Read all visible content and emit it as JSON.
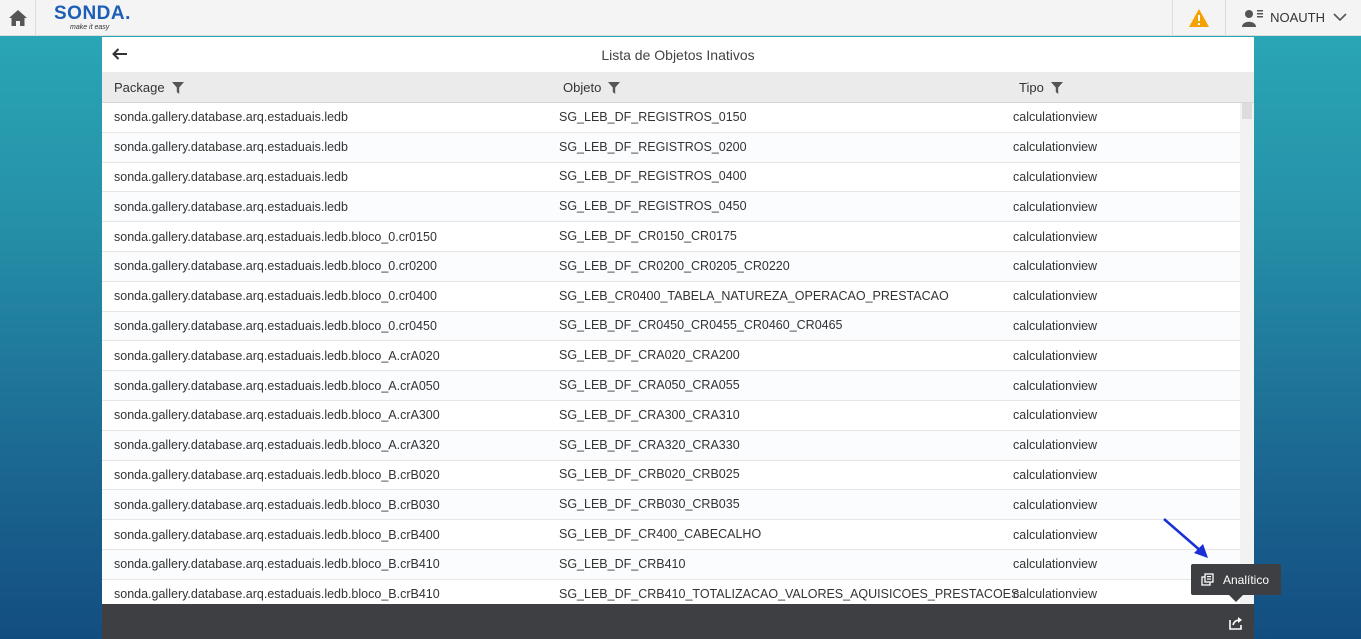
{
  "app": {
    "logo_text": "SONDA.",
    "logo_tagline": "make it easy",
    "user_name": "NOAUTH"
  },
  "icons": {
    "home": "home-icon",
    "warning": "warning-icon",
    "user": "user-menu-icon",
    "chevron": "chevron-down-icon",
    "back": "arrow-left-icon",
    "filter": "filter-icon",
    "share": "share-icon",
    "analytic": "analytic-icon"
  },
  "colors": {
    "brand": "#1c5fb5",
    "warning": "#f5a200",
    "footer": "#3d3f42"
  },
  "panel": {
    "title": "Lista de Objetos Inativos"
  },
  "table": {
    "columns": [
      "Package",
      "Objeto",
      "Tipo"
    ],
    "rows": [
      {
        "package": "sonda.gallery.database.arq.estaduais.ledb",
        "objeto": "SG_LEB_DF_REGISTROS_0150",
        "tipo": "calculationview"
      },
      {
        "package": "sonda.gallery.database.arq.estaduais.ledb",
        "objeto": "SG_LEB_DF_REGISTROS_0200",
        "tipo": "calculationview"
      },
      {
        "package": "sonda.gallery.database.arq.estaduais.ledb",
        "objeto": "SG_LEB_DF_REGISTROS_0400",
        "tipo": "calculationview"
      },
      {
        "package": "sonda.gallery.database.arq.estaduais.ledb",
        "objeto": "SG_LEB_DF_REGISTROS_0450",
        "tipo": "calculationview"
      },
      {
        "package": "sonda.gallery.database.arq.estaduais.ledb.bloco_0.cr0150",
        "objeto": "SG_LEB_DF_CR0150_CR0175",
        "tipo": "calculationview"
      },
      {
        "package": "sonda.gallery.database.arq.estaduais.ledb.bloco_0.cr0200",
        "objeto": "SG_LEB_DF_CR0200_CR0205_CR0220",
        "tipo": "calculationview"
      },
      {
        "package": "sonda.gallery.database.arq.estaduais.ledb.bloco_0.cr0400",
        "objeto": "SG_LEB_CR0400_TABELA_NATUREZA_OPERACAO_PRESTACAO",
        "tipo": "calculationview"
      },
      {
        "package": "sonda.gallery.database.arq.estaduais.ledb.bloco_0.cr0450",
        "objeto": "SG_LEB_DF_CR0450_CR0455_CR0460_CR0465",
        "tipo": "calculationview"
      },
      {
        "package": "sonda.gallery.database.arq.estaduais.ledb.bloco_A.crA020",
        "objeto": "SG_LEB_DF_CRA020_CRA200",
        "tipo": "calculationview"
      },
      {
        "package": "sonda.gallery.database.arq.estaduais.ledb.bloco_A.crA050",
        "objeto": "SG_LEB_DF_CRA050_CRA055",
        "tipo": "calculationview"
      },
      {
        "package": "sonda.gallery.database.arq.estaduais.ledb.bloco_A.crA300",
        "objeto": "SG_LEB_DF_CRA300_CRA310",
        "tipo": "calculationview"
      },
      {
        "package": "sonda.gallery.database.arq.estaduais.ledb.bloco_A.crA320",
        "objeto": "SG_LEB_DF_CRA320_CRA330",
        "tipo": "calculationview"
      },
      {
        "package": "sonda.gallery.database.arq.estaduais.ledb.bloco_B.crB020",
        "objeto": "SG_LEB_DF_CRB020_CRB025",
        "tipo": "calculationview"
      },
      {
        "package": "sonda.gallery.database.arq.estaduais.ledb.bloco_B.crB030",
        "objeto": "SG_LEB_DF_CRB030_CRB035",
        "tipo": "calculationview"
      },
      {
        "package": "sonda.gallery.database.arq.estaduais.ledb.bloco_B.crB400",
        "objeto": "SG_LEB_DF_CR400_CABECALHO",
        "tipo": "calculationview"
      },
      {
        "package": "sonda.gallery.database.arq.estaduais.ledb.bloco_B.crB410",
        "objeto": "SG_LEB_DF_CRB410",
        "tipo": "calculationview"
      },
      {
        "package": "sonda.gallery.database.arq.estaduais.ledb.bloco_B.crB410",
        "objeto": "SG_LEB_DF_CRB410_TOTALIZACAO_VALORES_AQUISICOES_PRESTACOES",
        "tipo": "calculationview"
      }
    ]
  },
  "tooltip": {
    "label": "Analítico"
  }
}
